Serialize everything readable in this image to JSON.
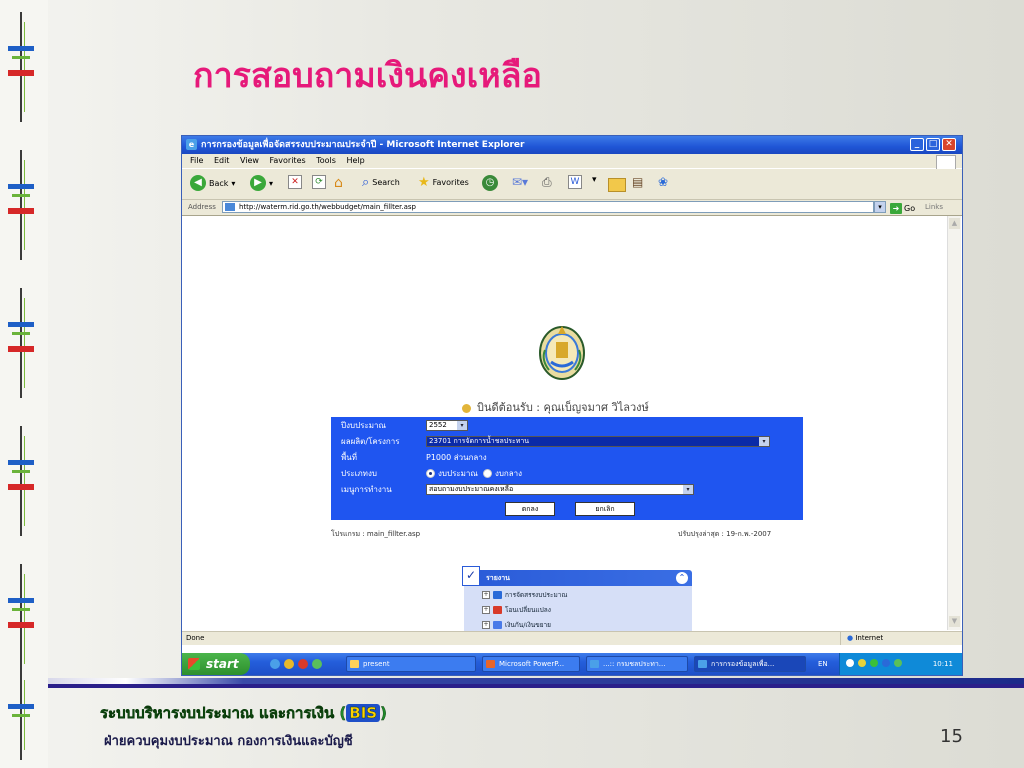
{
  "slide": {
    "title": "การสอบถามเงินคงเหลือ",
    "footer_line1": "ระบบบริหารงบประมาณ และการเงิน (",
    "footer_bis": "BIS",
    "footer_line1_end": ")",
    "footer_line2": "ฝ่ายควบคุมงบประมาณ กองการเงินและบัญชี",
    "page_number": "15"
  },
  "browser": {
    "title": "การกรองข้อมูลเพื่อจัดสรรงบประมาณประจำปี - Microsoft Internet Explorer",
    "menu": [
      "File",
      "Edit",
      "View",
      "Favorites",
      "Tools",
      "Help"
    ],
    "toolbar": {
      "back": "Back",
      "search": "Search",
      "favorites": "Favorites"
    },
    "address_label": "Address",
    "address_url": "http://waterm.rid.go.th/webbudget/main_fillter.asp",
    "go_label": "Go",
    "links_label": "Links",
    "status_left": "Done",
    "status_zone": "Internet"
  },
  "page": {
    "welcome": "บินดีต้อนรับ : คุณเบ็ญจมาศ วิไลวงษ์",
    "form": {
      "year_label": "ปีงบประมาณ",
      "year_value": "2552",
      "project_label": "ผลผลิต/โครงการ",
      "project_value": "23701 การจัดการน้ำชลประทาน",
      "area_label": "พื้นที่",
      "area_value": "P1000 ส่วนกลาง",
      "type_label": "ประเภทงบ",
      "type_opt1": "งบประมาณ",
      "type_opt2": "งบกลาง",
      "menu_label": "เมนูการทำงาน",
      "menu_value": "สอบถามงบประมาณคงเหลือ",
      "ok_button": "ตกลง",
      "cancel_button": "ยกเลิก"
    },
    "program_label": "โปรแกรม : main_fillter.asp",
    "updated_label": "ปรับปรุงล่าสุด : 19-ก.พ.-2007",
    "report": {
      "title": "รายงาน",
      "items": [
        "การจัดสรรงบประมาณ",
        "โอนเปลี่ยนแปลง",
        "เงินกัน/เงินขยาย"
      ]
    }
  },
  "taskbar": {
    "start": "start",
    "tasks": [
      "present",
      "Microsoft PowerP...",
      "...:: กรมชลประทา...",
      "การกรองข้อมูลเพื่อ..."
    ],
    "lang": "EN",
    "clock": "10:11"
  }
}
